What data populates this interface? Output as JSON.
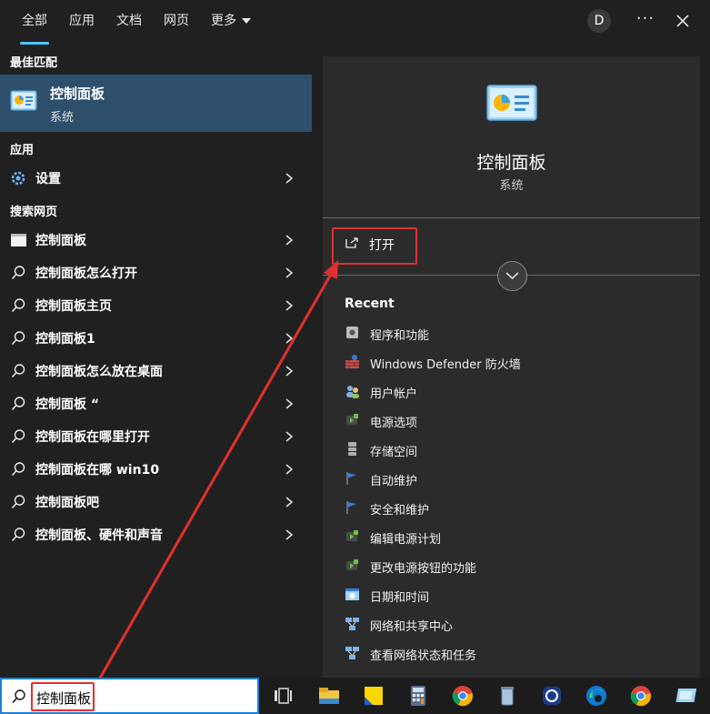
{
  "tabs": [
    "全部",
    "应用",
    "文档",
    "网页",
    "更多"
  ],
  "avatar": "D",
  "more_dots": "···",
  "sections": {
    "best_match": "最佳匹配",
    "apps": "应用",
    "web": "搜索网页"
  },
  "best": {
    "title": "控制面板",
    "subtitle": "系统"
  },
  "apps": [
    {
      "label": "设置",
      "icon": "gear-icon"
    }
  ],
  "web": [
    {
      "label": "控制面板",
      "icon": "web-result-icon"
    },
    {
      "label": "控制面板怎么打开",
      "icon": "search-icon"
    },
    {
      "label": "控制面板主页",
      "icon": "search-icon"
    },
    {
      "label": "控制面板1",
      "icon": "search-icon"
    },
    {
      "label": "控制面板怎么放在桌面",
      "icon": "search-icon"
    },
    {
      "label": "控制面板 “",
      "icon": "search-icon"
    },
    {
      "label": "控制面板在哪里打开",
      "icon": "search-icon"
    },
    {
      "label": "控制面板在哪 win10",
      "icon": "search-icon"
    },
    {
      "label": "控制面板吧",
      "icon": "search-icon"
    },
    {
      "label": "控制面板、硬件和声音",
      "icon": "search-icon"
    }
  ],
  "detail": {
    "title": "控制面板",
    "subtitle": "系统",
    "open": "打开",
    "recent_heading": "Recent",
    "recent": [
      "程序和功能",
      "Windows Defender 防火墙",
      "用户帐户",
      "电源选项",
      "存储空间",
      "自动维护",
      "安全和维护",
      "编辑电源计划",
      "更改电源按钮的功能",
      "日期和时间",
      "网络和共享中心",
      "查看网络状态和任务"
    ]
  },
  "search": {
    "value": "控制面板"
  },
  "colors": {
    "accent": "#4cc2ff",
    "selected": "#2d4f6c",
    "highlight": "#e03030",
    "panel": "#2b2b2b"
  }
}
